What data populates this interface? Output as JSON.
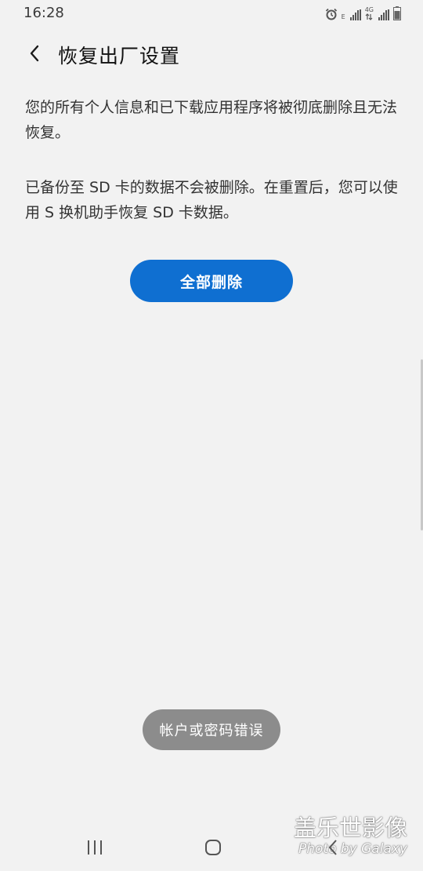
{
  "status_bar": {
    "time": "16:28",
    "sim1_label": "E",
    "sim2_label": "4G",
    "icons": [
      "alarm-icon",
      "signal-icon",
      "signal-icon",
      "battery-icon"
    ]
  },
  "header": {
    "back_icon": "chevron-left-icon",
    "title": "恢复出厂设置"
  },
  "content": {
    "paragraph_1": "您的所有个人信息和已下载应用程序将被彻底删除且无法恢复。",
    "paragraph_2": "已备份至 SD 卡的数据不会被删除。在重置后，您可以使用 S 换机助手恢复 SD 卡数据。",
    "delete_all_label": "全部删除"
  },
  "toast": {
    "message": "帐户或密码错误"
  },
  "watermark": {
    "line1": "盖乐世影像",
    "line2": "Photo by Galaxy"
  },
  "nav": {
    "icons": [
      "recents-icon",
      "home-icon",
      "back-icon"
    ]
  },
  "colors": {
    "background": "#f2f2f2",
    "accent": "#0f6fd1",
    "toast_bg": "#8c8c8c"
  }
}
